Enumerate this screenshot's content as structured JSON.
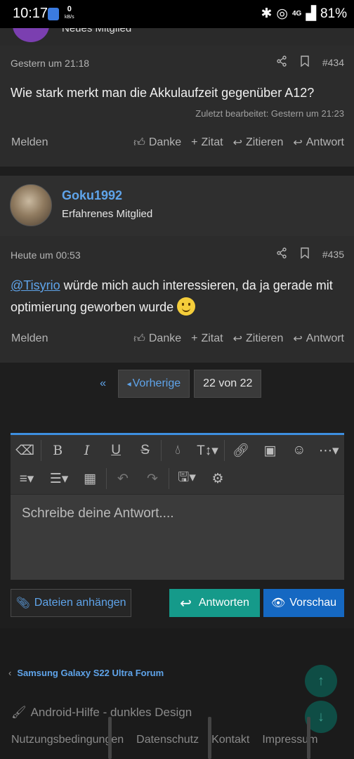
{
  "statusbar": {
    "time": "10:17",
    "net_value": "0",
    "net_unit": "kB/s",
    "battery": "81%",
    "signal": "4G"
  },
  "prev_post_cut": {
    "text": "Neues Mitglied"
  },
  "post434": {
    "timestamp": "Gestern um 21:18",
    "number": "#434",
    "body": "Wie stark merkt man die Akkulaufzeit gegenüber A12?",
    "edited": "Zuletzt bearbeitet: Gestern um 21:23"
  },
  "actions": {
    "report": "Melden",
    "like": "Danke",
    "quote_add": "Zitat",
    "quote": "Zitieren",
    "reply": "Antwort"
  },
  "user": {
    "name": "Goku1992",
    "rank": "Erfahrenes Mitglied"
  },
  "post435": {
    "timestamp": "Heute um 00:53",
    "number": "#435",
    "mention": "@Tisyrio",
    "body": " würde mich auch interessieren, da ja gerade mit optimierung geworben wurde "
  },
  "pager": {
    "prev": "Vorherige",
    "current": "22 von 22"
  },
  "editor": {
    "placeholder": "Schreibe deine Antwort...."
  },
  "buttons": {
    "attach": "Dateien anhängen",
    "reply": "Antworten",
    "preview": "Vorschau"
  },
  "footer": {
    "breadcrumb": "Samsung Galaxy S22 Ultra Forum",
    "style": "Android-Hilfe - dunkles Design",
    "links": [
      "Nutzungsbedingungen",
      "Datenschutz",
      "Kontakt",
      "Impressum"
    ]
  },
  "colors": {
    "accent": "#5fa4ea",
    "reply_button": "#159a8a",
    "preview_button": "#1568c2",
    "editor_bar": "#3d8fe0"
  }
}
